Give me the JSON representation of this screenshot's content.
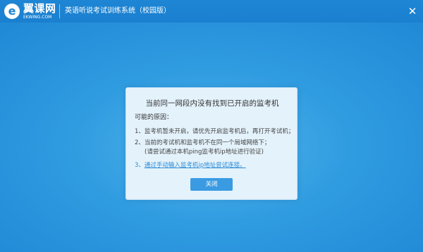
{
  "brand": {
    "logo_glyph": "e",
    "name_cn": "翼课网",
    "name_en": "EKWING.COM"
  },
  "window": {
    "title": "英语听说考试训练系统（校园版）",
    "close_glyph": "✕"
  },
  "dialog": {
    "title": "当前同一网段内没有找到已开启的监考机",
    "reasons_label": "可能的原因：",
    "items": [
      {
        "num": "1、",
        "text": "监考机暂未开启，请优先开启监考机后，再打开考试机；"
      },
      {
        "num": "2、",
        "text": "当前的考试机和监考机不在同一个局域网络下；",
        "sub": "(请尝试通过本机ping监考机ip地址进行验证)"
      },
      {
        "num": "3、",
        "link": "通过手动输入监考机ip地址尝试连接。"
      }
    ],
    "close_button": "关闭"
  },
  "colors": {
    "background": "#2f9be0",
    "titlebar": "#1e86d4",
    "dialog_bg": "#e4f2fb",
    "link": "#2a8cd8",
    "button": "#3a9be2"
  }
}
